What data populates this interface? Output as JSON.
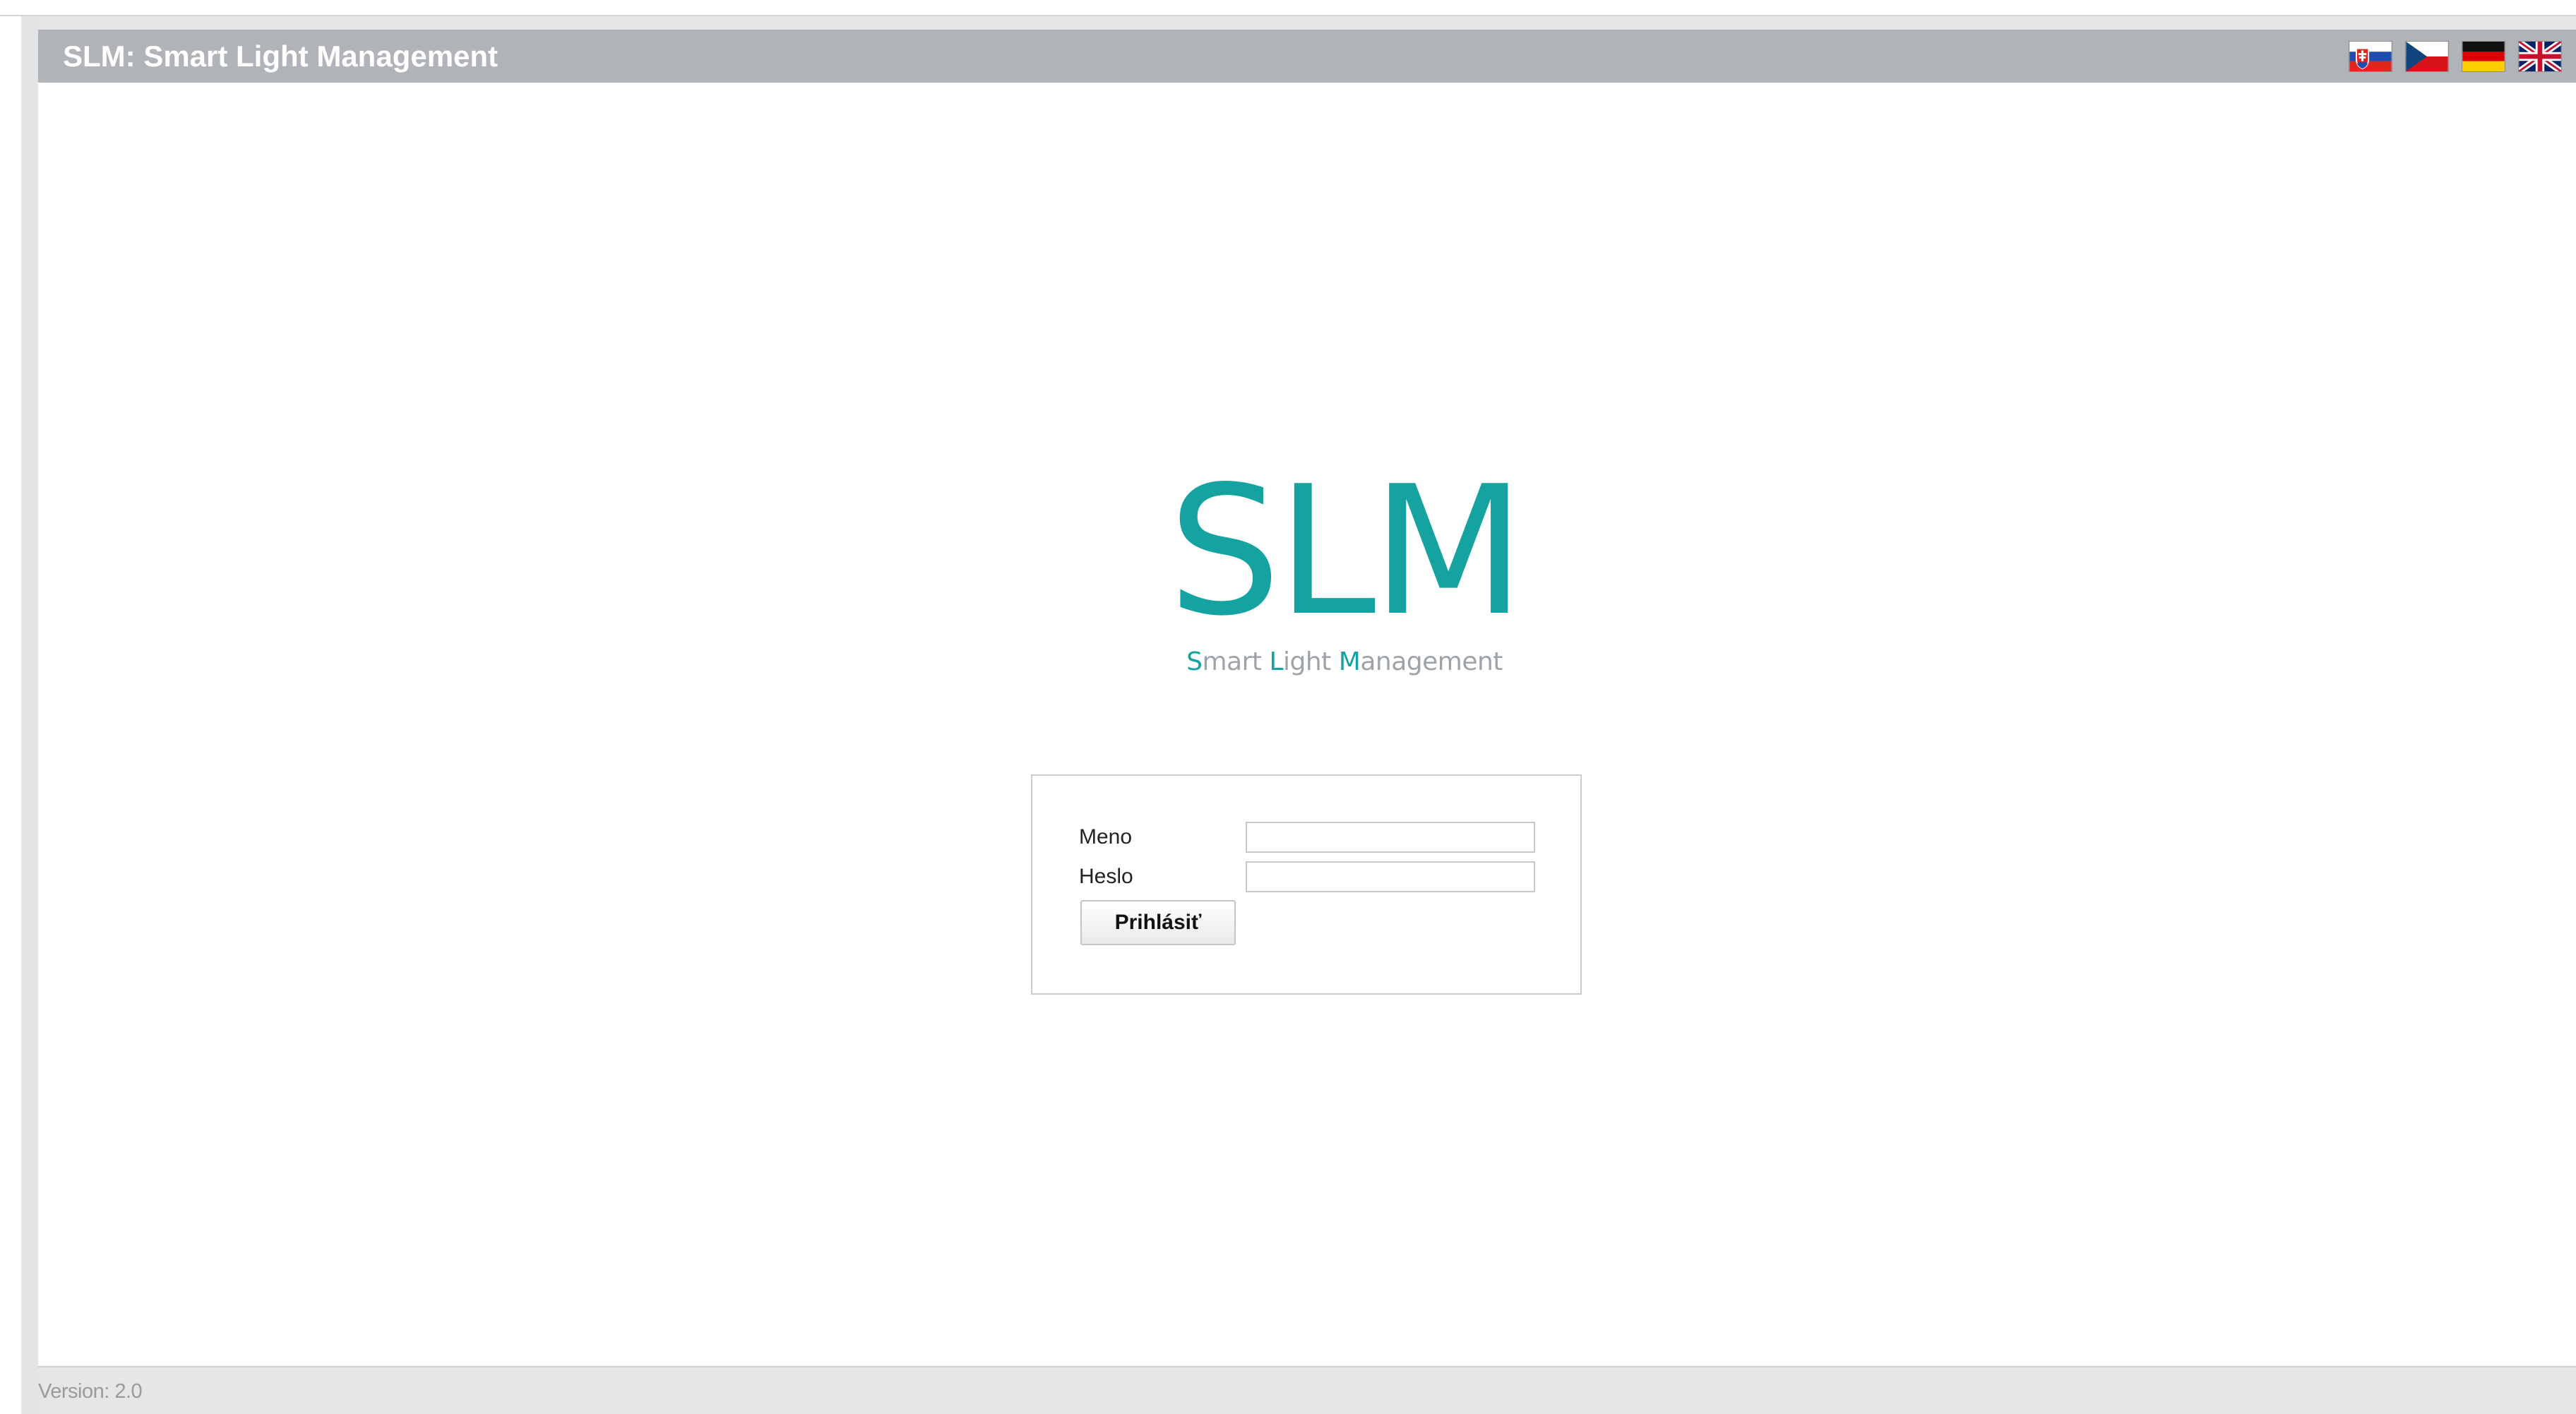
{
  "header": {
    "title": "SLM: Smart Light Management",
    "languages": [
      {
        "code": "sk",
        "icon": "slovak-flag-icon"
      },
      {
        "code": "cs",
        "icon": "czech-flag-icon"
      },
      {
        "code": "de",
        "icon": "german-flag-icon"
      },
      {
        "code": "en",
        "icon": "uk-flag-icon"
      }
    ]
  },
  "logo": {
    "text": "SLM",
    "tagline_parts": [
      "S",
      "mart ",
      "L",
      "ight ",
      "M",
      "anagement"
    ],
    "color": "#14a3a1"
  },
  "login": {
    "name_label": "Meno",
    "name_value": "",
    "password_label": "Heslo",
    "password_value": "",
    "submit_label": "Prihlásiť"
  },
  "footer": {
    "version": "Version: 2.0"
  },
  "colors": {
    "header_bg": "#b0b3b8",
    "accent": "#14a3a1",
    "tagline_gray": "#9da3a8"
  }
}
